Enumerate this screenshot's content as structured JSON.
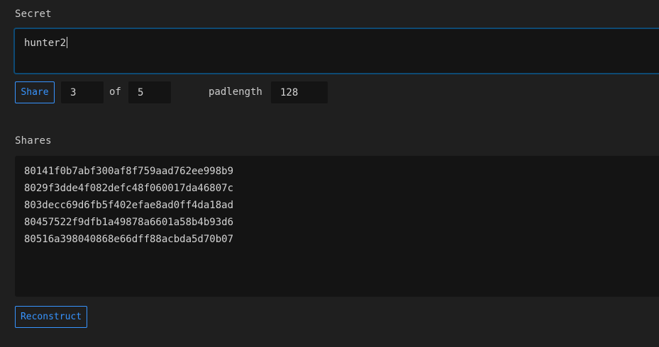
{
  "secret": {
    "label": "Secret",
    "value": "hunter2"
  },
  "controls": {
    "share_button": "Share",
    "threshold": "3",
    "of_label": "of",
    "total": "5",
    "padlength_label": "padlength",
    "padlength": "128"
  },
  "shares": {
    "label": "Shares",
    "items": [
      "80141f0b7abf300af8f759aad762ee998b9",
      "8029f3dde4f082defc48f060017da46807c",
      "803decc69d6fb5f402efae8ad0ff4da18ad",
      "80457522f9dfb1a49878a6601a58b4b93d6",
      "80516a398040868e66dff88acbda5d70b07"
    ]
  },
  "reconstruct_button": "Reconstruct",
  "colors": {
    "accent": "#3794ff",
    "focus_border": "#0e4a74",
    "background": "#1f1f1f",
    "field": "#141414"
  }
}
